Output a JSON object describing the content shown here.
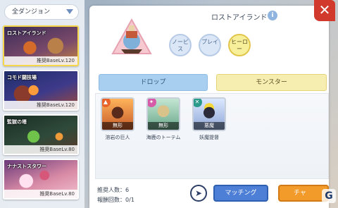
{
  "sidebar": {
    "filter_label": "全ダンジョン",
    "dungeons": [
      {
        "name": "ロストアイランド",
        "level": "推奨BaseLv.120",
        "selected": true
      },
      {
        "name": "コモド闘技場",
        "level": "推奨BaseLv.120",
        "selected": false
      },
      {
        "name": "監獄の塔",
        "level": "推奨BaseLv.80",
        "selected": false
      },
      {
        "name": "ナナストスタワー",
        "level": "推奨BaseLv.80",
        "selected": false
      }
    ]
  },
  "detail": {
    "title": "ロストアイランド",
    "info_icon": "i",
    "difficulties": [
      {
        "label": "ノービス",
        "active": false
      },
      {
        "label": "プレイ",
        "active": false
      },
      {
        "label": "ヒーロー",
        "active": true
      }
    ],
    "tabs": {
      "drop": "ドロップ",
      "monster": "モンスター"
    },
    "monsters": [
      {
        "name": "溶岩の巨人",
        "type": "無形",
        "badge_icon": "fire-icon",
        "badge_color": "#e8642a"
      },
      {
        "name": "海鹿のトーテム",
        "type": "無形",
        "badge_icon": "holy-icon",
        "badge_color": "#d65aa8"
      },
      {
        "name": "妖魔提督",
        "type": "悪魔",
        "badge_icon": "shadow-icon",
        "badge_color": "#2a9a8a"
      }
    ],
    "recommended_players": "推奨人数：6",
    "reward_count": "報酬回数：0/1",
    "buttons": {
      "matching": "マッチング",
      "challenge": "チャ"
    }
  },
  "watermark": "G",
  "colors": {
    "close": "#d0392b",
    "matching": "#4d7fd6",
    "challenge": "#f29b2a"
  }
}
